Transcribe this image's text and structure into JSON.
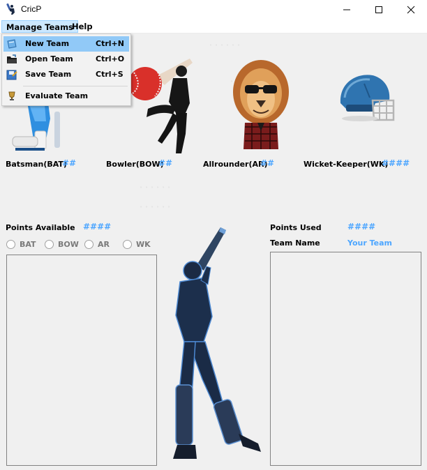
{
  "window": {
    "title": "CricP"
  },
  "menubar": {
    "manage_teams": "Manage Teams",
    "help": "Help"
  },
  "dropdown": {
    "items": [
      {
        "label": "New Team",
        "shortcut": "Ctrl+N",
        "icon": "new-team-icon"
      },
      {
        "label": "Open Team",
        "shortcut": "Ctrl+O",
        "icon": "folder-icon"
      },
      {
        "label": "Save Team",
        "shortcut": "Ctrl+S",
        "icon": "save-icon"
      },
      {
        "label": "Evaluate Team",
        "shortcut": "",
        "icon": "trophy-icon"
      }
    ]
  },
  "roles": {
    "bat": {
      "label": "Batsman(BAT)",
      "count": "##"
    },
    "bow": {
      "label": "Bowler(BOW)",
      "count": "##"
    },
    "ar": {
      "label": "Allrounder(AR)",
      "count": "##"
    },
    "wk": {
      "label": "Wicket-Keeper(WK)",
      "count": "####"
    }
  },
  "points": {
    "available_label": "Points Available",
    "available_value": "####",
    "used_label": "Points Used",
    "used_value": "####"
  },
  "team": {
    "name_label": "Team Name",
    "name_value": "Your Team"
  },
  "filters": {
    "bat": "BAT",
    "bow": "BOW",
    "ar": "AR",
    "wk": "WK"
  },
  "colors": {
    "accent": "#4da6ff",
    "menu_highlight": "#91c9f7",
    "cricket_ball": "#d9302a"
  }
}
